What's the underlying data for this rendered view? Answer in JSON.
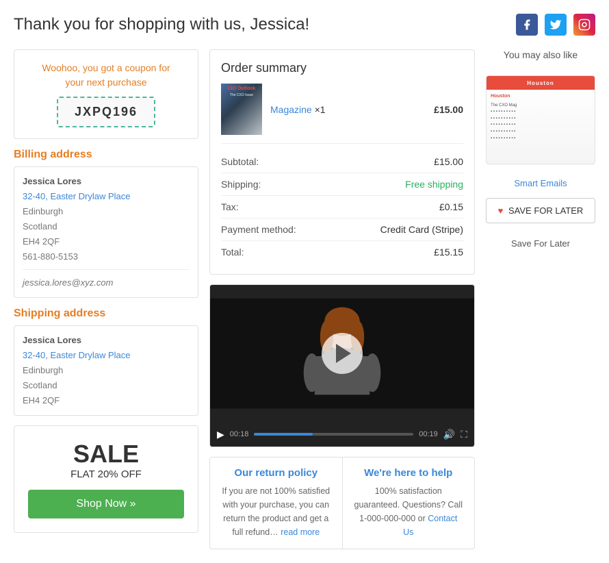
{
  "header": {
    "title": "Thank you for shopping with us, Jessica!",
    "social": {
      "facebook_label": "f",
      "twitter_label": "t",
      "instagram_label": "ig"
    }
  },
  "coupon": {
    "text_line1": "Woohoo, you got a coupon for",
    "text_line2": "your next purchase",
    "code": "JXPQ196"
  },
  "billing": {
    "section_title": "Billing address",
    "name": "Jessica Lores",
    "street": "32-40, Easter Drylaw Place",
    "city": "Edinburgh",
    "region": "Scotland",
    "postcode": "EH4 2QF",
    "phone": "561-880-5153",
    "email": "jessica.lores@xyz.com"
  },
  "shipping": {
    "section_title": "Shipping address",
    "name": "Jessica Lores",
    "street": "32-40, Easter Drylaw Place",
    "city": "Edinburgh",
    "region": "Scotland",
    "postcode": "EH4 2QF"
  },
  "sale": {
    "title": "SALE",
    "subtitle": "FLAT 20% OFF",
    "button_label": "Shop Now »"
  },
  "order_summary": {
    "title": "Order summary",
    "item_name": "Magazine",
    "item_qty": "×1",
    "item_price": "£15.00",
    "rows": [
      {
        "label": "Subtotal:",
        "value": "£15.00",
        "type": "normal"
      },
      {
        "label": "Shipping:",
        "value": "Free shipping",
        "type": "green"
      },
      {
        "label": "Tax:",
        "value": "£0.15",
        "type": "normal"
      },
      {
        "label": "Payment method:",
        "value": "Credit Card (Stripe)",
        "type": "normal"
      },
      {
        "label": "Total:",
        "value": "£15.15",
        "type": "normal"
      }
    ]
  },
  "video": {
    "time_start": "00:18",
    "time_end": "00:19",
    "progress_pct": 37
  },
  "return_policy": {
    "title": "Our return policy",
    "text": "If you are not 100% satisfied with your purchase, you can return the product and get a full refund…",
    "read_more": "read more"
  },
  "help": {
    "title": "We're here to help",
    "text": "100% satisfaction guaranteed. Questions? Call 1-000-000-000 or",
    "contact_link": "Contact Us"
  },
  "you_may_like": {
    "title": "You may also like",
    "product_label": "Smart Emails",
    "mag_header": "Houston",
    "save_button": "SAVE FOR LATER",
    "save_label": "Save For Later"
  }
}
